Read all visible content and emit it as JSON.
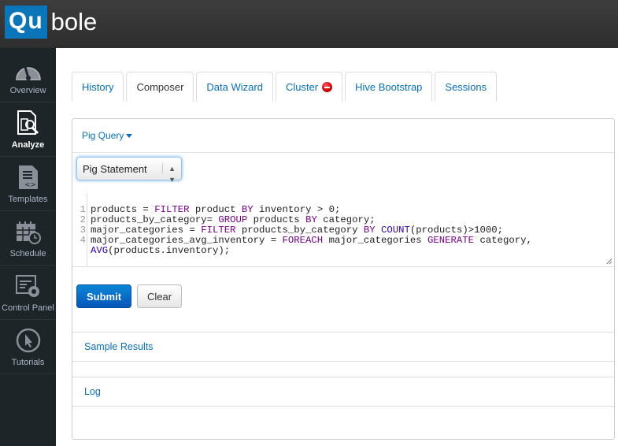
{
  "app": {
    "logo_left": "Qu",
    "logo_right": "bole",
    "brand_color": "#0a75b8"
  },
  "sidebar": {
    "items": [
      {
        "label": "Overview",
        "icon": "gauge-icon"
      },
      {
        "label": "Analyze",
        "icon": "analyze-icon",
        "active": true
      },
      {
        "label": "Templates",
        "icon": "template-icon"
      },
      {
        "label": "Schedule",
        "icon": "calendar-clock-icon"
      },
      {
        "label": "Control Panel",
        "icon": "control-panel-icon"
      },
      {
        "label": "Tutorials",
        "icon": "cursor-icon"
      }
    ]
  },
  "tabs": [
    {
      "label": "History"
    },
    {
      "label": "Composer",
      "active": true
    },
    {
      "label": "Data Wizard"
    },
    {
      "label": "Cluster",
      "icon": "cluster-status-icon"
    },
    {
      "label": "Hive Bootstrap"
    },
    {
      "label": "Sessions"
    }
  ],
  "panel": {
    "query_type": "Pig Query",
    "statement_select": "Pig Statement",
    "code_lines": [
      {
        "num": "1",
        "tokens": [
          [
            "products = ",
            ""
          ],
          [
            "FILTER",
            "kw"
          ],
          [
            " product ",
            ""
          ],
          [
            "BY",
            "kw"
          ],
          [
            " inventory > 0;",
            ""
          ]
        ]
      },
      {
        "num": "2",
        "tokens": [
          [
            "products_by_category= ",
            ""
          ],
          [
            "GROUP",
            "kw"
          ],
          [
            " products ",
            ""
          ],
          [
            "BY",
            "kw"
          ],
          [
            " category;",
            ""
          ]
        ]
      },
      {
        "num": "3",
        "tokens": [
          [
            "major_categories = ",
            ""
          ],
          [
            "FILTER",
            "kw"
          ],
          [
            " products_by_category ",
            ""
          ],
          [
            "BY",
            "kw"
          ],
          [
            " ",
            ""
          ],
          [
            "COUNT",
            "fn"
          ],
          [
            "(products)>1000;",
            ""
          ]
        ]
      },
      {
        "num": "4",
        "tokens": [
          [
            "major_categories_avg_inventory = ",
            ""
          ],
          [
            "FOREACH",
            "kw"
          ],
          [
            " major_categories ",
            ""
          ],
          [
            "GENERATE",
            "kw"
          ],
          [
            " category,",
            ""
          ]
        ]
      },
      {
        "num": "",
        "tokens": [
          [
            "AVG",
            "fn"
          ],
          [
            "(products.inventory);",
            ""
          ]
        ]
      }
    ],
    "submit_label": "Submit",
    "clear_label": "Clear",
    "sample_results": "Sample Results",
    "log": "Log"
  }
}
